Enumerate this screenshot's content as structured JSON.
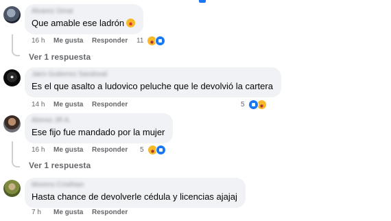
{
  "comments": [
    {
      "author": "Alvarez Omar",
      "text": "Que amable ese ladrón",
      "time": "16 h",
      "like_label": "Me gusta",
      "reply_label": "Responder",
      "reaction_count": "11",
      "reactions": [
        "haha-icon",
        "like-icon"
      ],
      "replies_label": "Ver 1 respuesta"
    },
    {
      "author": "Jairo Gutierrez Sandoval",
      "text": "Es el que asalto a ludovico peluche que le devolvió la cartera",
      "time": "14 h",
      "like_label": "Me gusta",
      "reply_label": "Responder",
      "reaction_count": "5",
      "reactions": [
        "like-icon",
        "haha-icon"
      ]
    },
    {
      "author": "Alonso JR A.",
      "text": "Ese fijo fue mandado por la mujer",
      "time": "16 h",
      "like_label": "Me gusta",
      "reply_label": "Responder",
      "reaction_count": "5",
      "reactions": [
        "haha-icon",
        "like-icon"
      ],
      "replies_label": "Ver 1 respuesta"
    },
    {
      "author": "Moreno Cristhian",
      "text": "Hasta chance de devolverle cédula y licencias ajajaj",
      "time": "7 h",
      "like_label": "Me gusta",
      "reply_label": "Responder"
    }
  ],
  "colors": {
    "bubble": "#f0f2f5",
    "meta": "#65676b",
    "like_blue": "#1877f2",
    "haha_yellow": "#f7b928"
  }
}
